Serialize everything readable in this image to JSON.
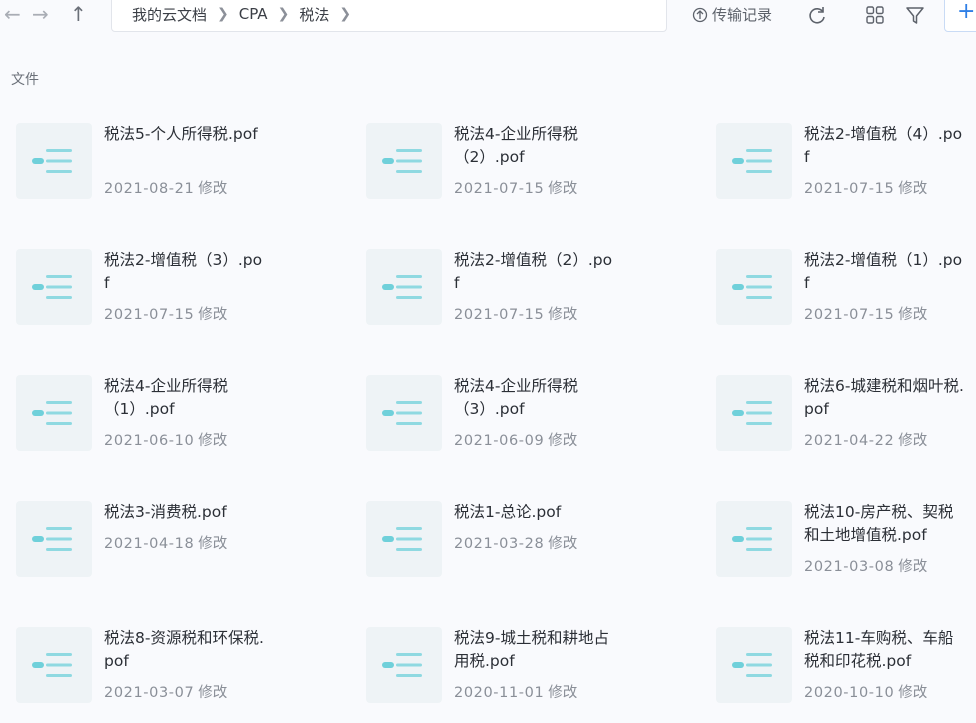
{
  "toolbar": {
    "back_icon": "arrow-left-icon",
    "forward_icon": "arrow-right-icon",
    "up_icon": "arrow-up-icon",
    "breadcrumb": [
      "我的云文档",
      "CPA",
      "税法"
    ],
    "transfer_label": "传输记录",
    "refresh_icon": "refresh-icon",
    "view_icon": "grid-view-icon",
    "filter_icon": "filter-icon",
    "add_label": "+"
  },
  "section_label": "文件",
  "files": [
    {
      "name": "税法5-个人所得税.pof",
      "date": "2021-08-21",
      "suffix": "修改"
    },
    {
      "name": "税法4-企业所得税（2）.pof",
      "date": "2021-07-15",
      "suffix": "修改"
    },
    {
      "name": "税法2-增值税（4）.pof",
      "date": "2021-07-15",
      "suffix": "修改"
    },
    {
      "name": "税法2-增值税（3）.pof",
      "date": "2021-07-15",
      "suffix": "修改"
    },
    {
      "name": "税法2-增值税（2）.pof",
      "date": "2021-07-15",
      "suffix": "修改"
    },
    {
      "name": "税法2-增值税（1）.pof",
      "date": "2021-07-15",
      "suffix": "修改"
    },
    {
      "name": "税法4-企业所得税（1）.pof",
      "date": "2021-06-10",
      "suffix": "修改"
    },
    {
      "name": "税法4-企业所得税（3）.pof",
      "date": "2021-06-09",
      "suffix": "修改"
    },
    {
      "name": "税法6-城建税和烟叶税.pof",
      "date": "2021-04-22",
      "suffix": "修改"
    },
    {
      "name": "税法3-消费税.pof",
      "date": "2021-04-18",
      "suffix": "修改"
    },
    {
      "name": "税法1-总论.pof",
      "date": "2021-03-28",
      "suffix": "修改"
    },
    {
      "name": "税法10-房产税、契税和土地增值税.pof",
      "date": "2021-03-08",
      "suffix": "修改"
    },
    {
      "name": "税法8-资源税和环保税.pof",
      "date": "2021-03-07",
      "suffix": "修改"
    },
    {
      "name": "税法9-城土税和耕地占用税.pof",
      "date": "2020-11-01",
      "suffix": "修改"
    },
    {
      "name": "税法11-车购税、车船税和印花税.pof",
      "date": "2020-10-10",
      "suffix": "修改"
    }
  ],
  "colors": {
    "accent": "#2f7fe6",
    "thumb_bg": "#eef3f6",
    "thumb_mark": "#6fd0da"
  }
}
